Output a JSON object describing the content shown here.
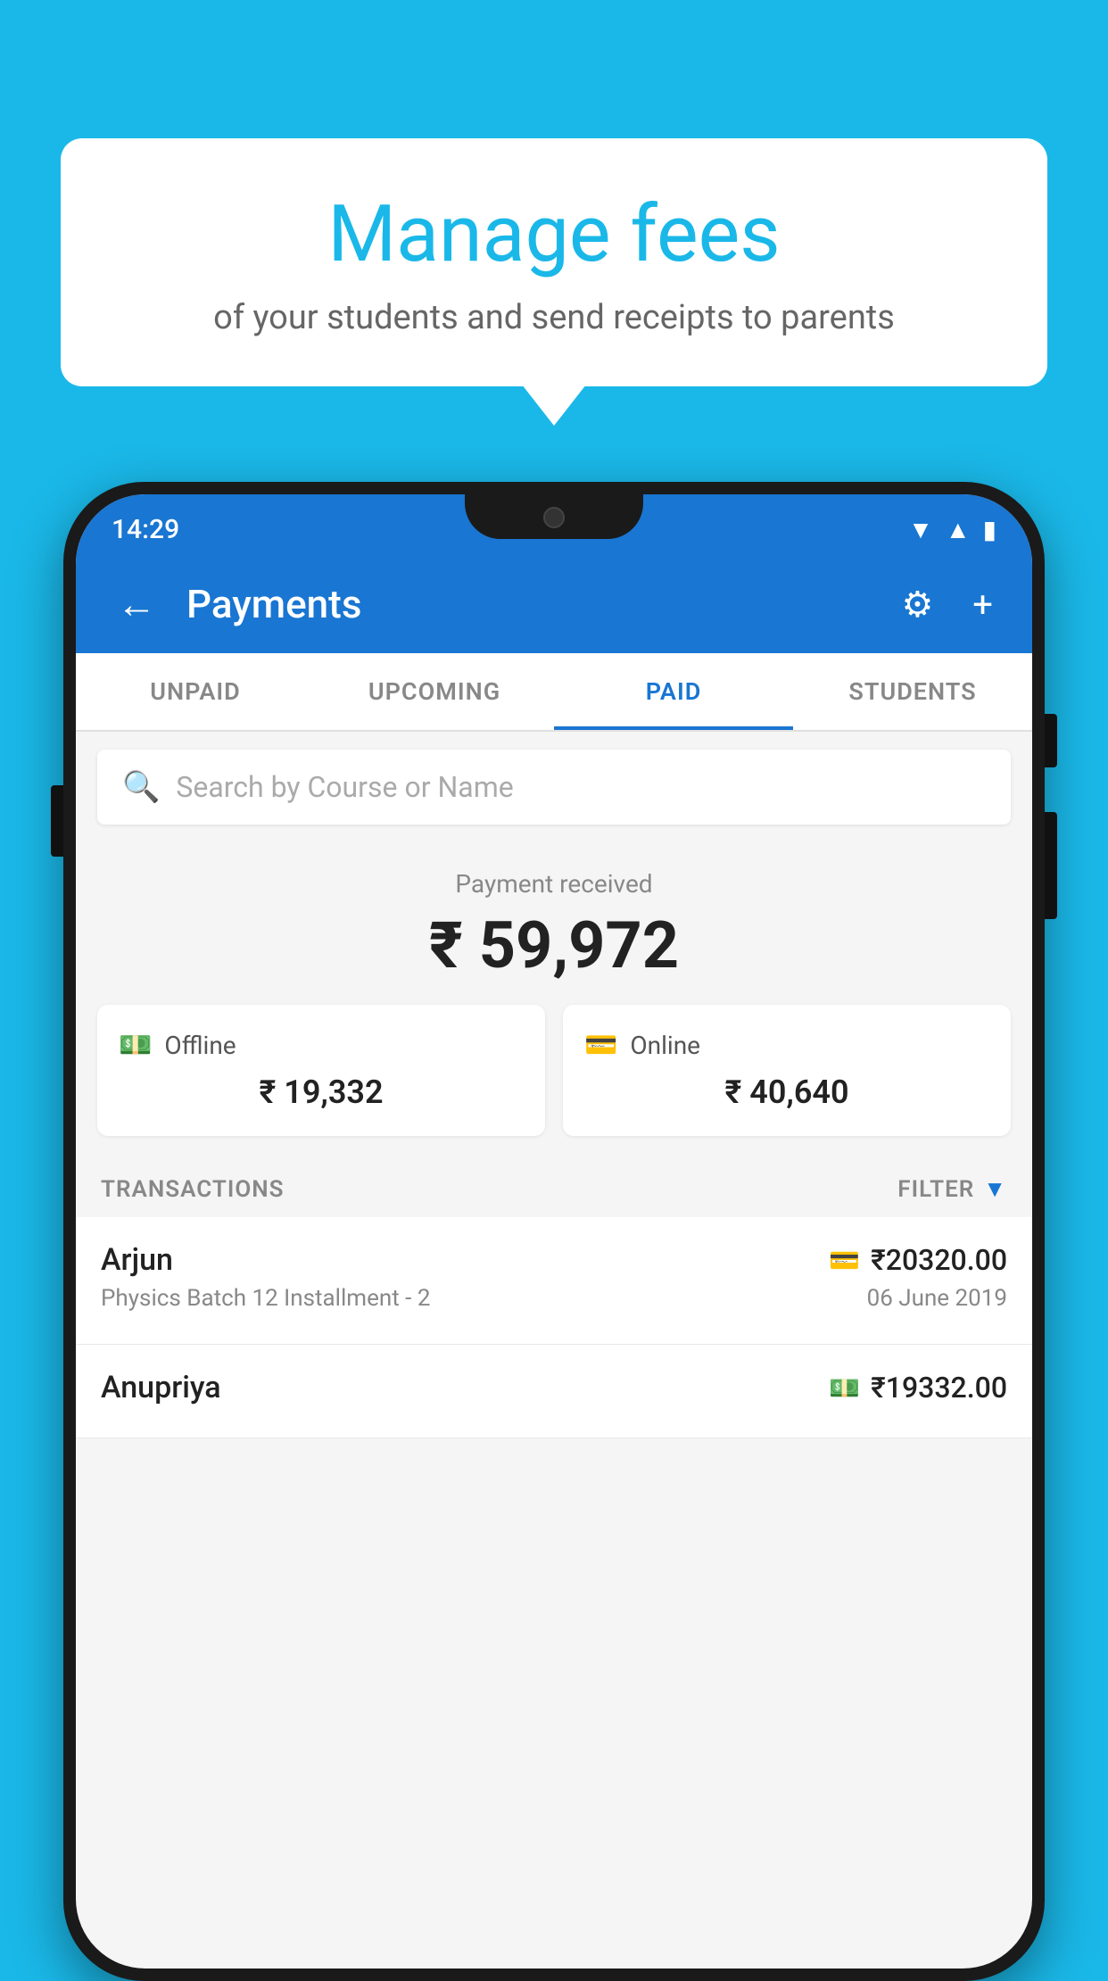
{
  "background_color": "#1ab8e8",
  "bubble": {
    "title": "Manage fees",
    "subtitle": "of your students and send receipts to parents"
  },
  "status_bar": {
    "time": "14:29",
    "wifi": "▾",
    "signal": "▾",
    "battery": "▮"
  },
  "app_bar": {
    "title": "Payments",
    "back_icon": "←",
    "settings_icon": "⚙",
    "add_icon": "+"
  },
  "tabs": [
    {
      "label": "UNPAID",
      "active": false
    },
    {
      "label": "UPCOMING",
      "active": false
    },
    {
      "label": "PAID",
      "active": true
    },
    {
      "label": "STUDENTS",
      "active": false
    }
  ],
  "search": {
    "placeholder": "Search by Course or Name"
  },
  "payment_summary": {
    "label": "Payment received",
    "amount": "₹ 59,972",
    "offline": {
      "label": "Offline",
      "amount": "₹ 19,332"
    },
    "online": {
      "label": "Online",
      "amount": "₹ 40,640"
    }
  },
  "transactions": {
    "header": "TRANSACTIONS",
    "filter": "FILTER",
    "items": [
      {
        "name": "Arjun",
        "detail": "Physics Batch 12 Installment - 2",
        "amount": "₹20320.00",
        "date": "06 June 2019",
        "mode": "card"
      },
      {
        "name": "Anupriya",
        "detail": "",
        "amount": "₹19332.00",
        "date": "",
        "mode": "cash"
      }
    ]
  }
}
